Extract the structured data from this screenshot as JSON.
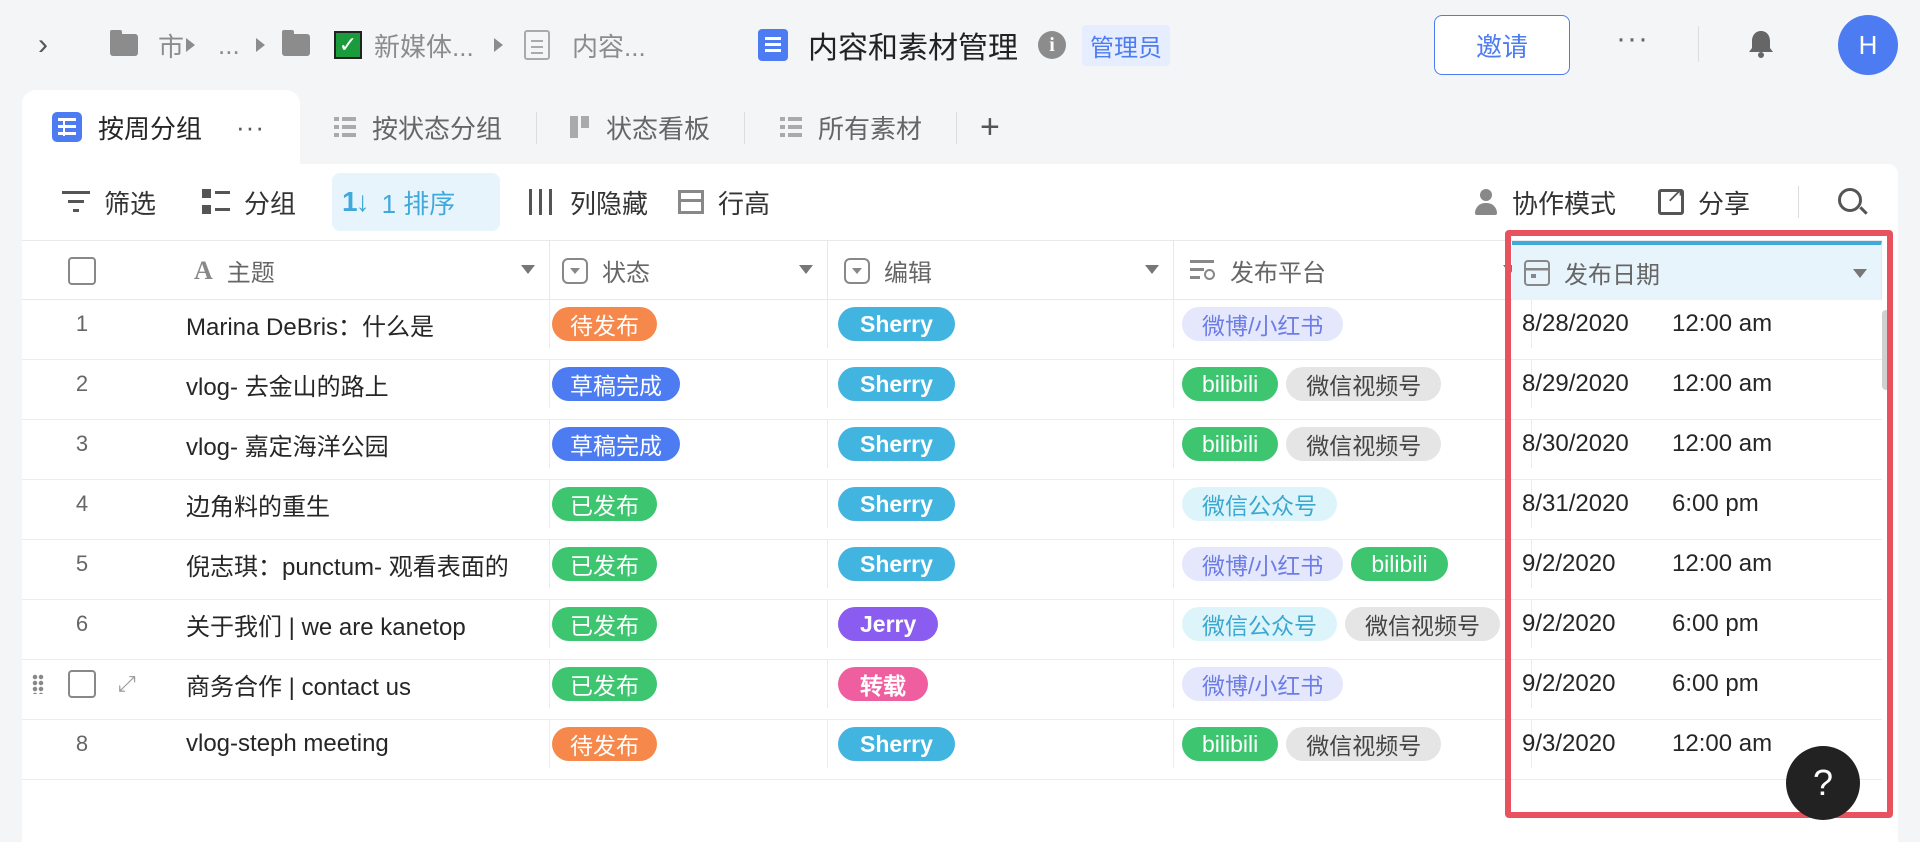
{
  "breadcrumb": {
    "item1": "市",
    "item2": "...",
    "item3": "新媒体...",
    "item4": "内容..."
  },
  "document": {
    "title": "内容和素材管理",
    "role": "管理员"
  },
  "header": {
    "invite_label": "邀请",
    "more_label": "···",
    "avatar_initial": "H"
  },
  "views": {
    "tabs": [
      {
        "label": "按周分组",
        "icon": "grid-icon",
        "active": true
      },
      {
        "label": "按状态分组",
        "icon": "list-icon"
      },
      {
        "label": "状态看板",
        "icon": "kanban-icon"
      },
      {
        "label": "所有素材",
        "icon": "list-icon"
      }
    ],
    "more_label": "···",
    "add_label": "+"
  },
  "toolbar": {
    "filter": "筛选",
    "group": "分组",
    "sort": "1 排序",
    "hide_columns": "列隐藏",
    "row_height": "行高",
    "collab_mode": "协作模式",
    "share": "分享"
  },
  "columns": {
    "topic": "主题",
    "status": "状态",
    "editor": "编辑",
    "platform": "发布平台",
    "publish_date": "发布日期"
  },
  "rows": [
    {
      "num": "1",
      "topic": "Marina DeBris：什么是",
      "status": "待发布",
      "editor": "Sherry",
      "platforms": [
        "微博/小红书"
      ],
      "date": "8/28/2020",
      "time": "12:00 am"
    },
    {
      "num": "2",
      "topic": "vlog- 去金山的路上",
      "status": "草稿完成",
      "editor": "Sherry",
      "platforms": [
        "bilibili",
        "微信视频号"
      ],
      "date": "8/29/2020",
      "time": "12:00 am"
    },
    {
      "num": "3",
      "topic": "vlog- 嘉定海洋公园",
      "status": "草稿完成",
      "editor": "Sherry",
      "platforms": [
        "bilibili",
        "微信视频号"
      ],
      "date": "8/30/2020",
      "time": "12:00 am"
    },
    {
      "num": "4",
      "topic": "边角料的重生",
      "status": "已发布",
      "editor": "Sherry",
      "platforms": [
        "微信公众号"
      ],
      "date": "8/31/2020",
      "time": "6:00 pm"
    },
    {
      "num": "5",
      "topic": "倪志琪：punctum- 观看表面的",
      "status": "已发布",
      "editor": "Sherry",
      "platforms": [
        "微博/小红书",
        "bilibili"
      ],
      "date": "9/2/2020",
      "time": "12:00 am"
    },
    {
      "num": "6",
      "topic": "关于我们 | we are kanetop",
      "status": "已发布",
      "editor": "Jerry",
      "platforms": [
        "微信公众号",
        "微信视频号"
      ],
      "date": "9/2/2020",
      "time": "6:00 pm"
    },
    {
      "num": "",
      "topic": "商务合作 | contact us",
      "status": "已发布",
      "editor": "转载",
      "platforms": [
        "微博/小红书"
      ],
      "date": "9/2/2020",
      "time": "6:00 pm"
    },
    {
      "num": "8",
      "topic": "vlog-steph meeting",
      "status": "待发布",
      "editor": "Sherry",
      "platforms": [
        "bilibili",
        "微信视频号"
      ],
      "date": "9/3/2020",
      "time": "12:00 am"
    }
  ],
  "colors": {
    "待发布": "#f5884a",
    "草稿完成": "#4d7cf2",
    "已发布": "#3ec56f",
    "Sherry": "#42b4e0",
    "Jerry": "#8b5cf0",
    "转载": "#ef5f9f",
    "微博/小红书": {
      "bg": "#e5e8fc",
      "fg": "#6d7de6"
    },
    "bilibili": {
      "bg": "#3ec56f",
      "fg": "#ffffff"
    },
    "微信视频号": {
      "bg": "#e5e5e5",
      "fg": "#444444"
    },
    "微信公众号": {
      "bg": "#ddf4fb",
      "fg": "#3aa8d0"
    }
  },
  "help_label": "?"
}
